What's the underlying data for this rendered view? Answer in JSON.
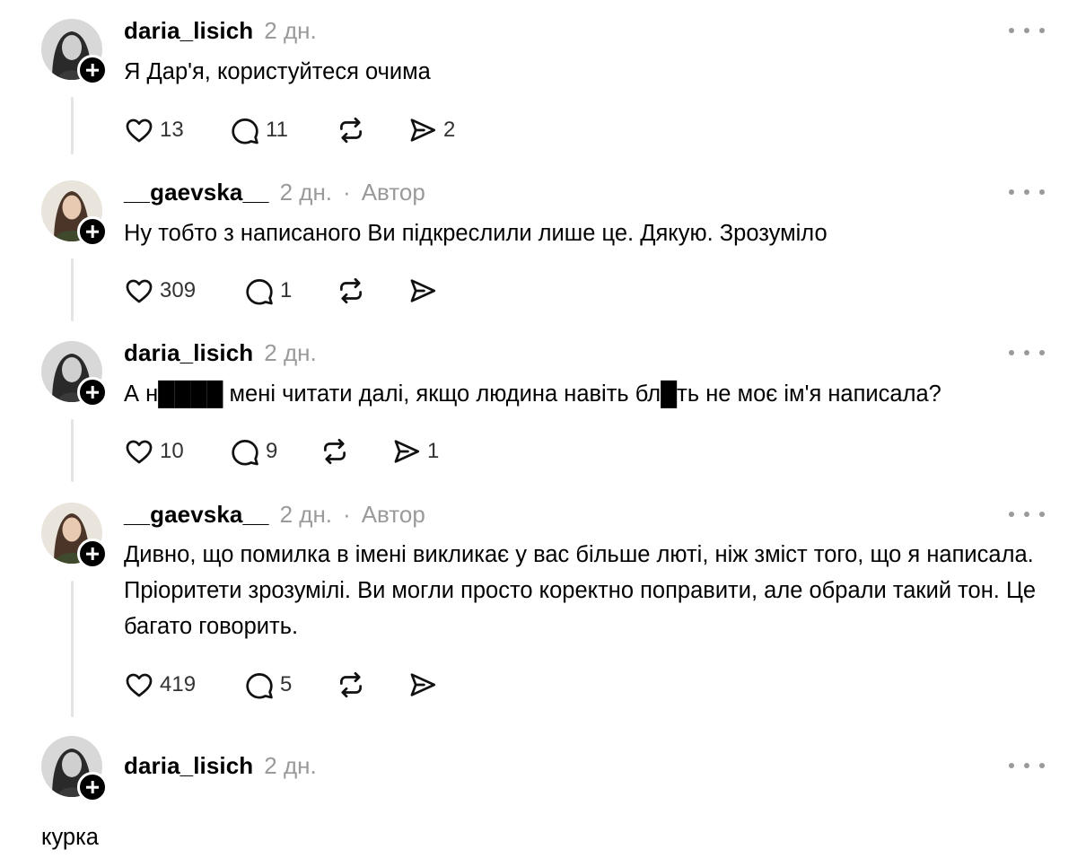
{
  "comments": [
    {
      "username": "daria_lisich",
      "time": "2 дн.",
      "badge": "",
      "text": "Я Дар'я, користуйтеся очима",
      "likes": "13",
      "replies": "11",
      "reposts": "",
      "shares": "2"
    },
    {
      "username": "__gaevska__",
      "time": "2 дн.",
      "badge": "Автор",
      "text": "Ну тобто з написаного Ви підкреслили лише це. Дякую. Зрозуміло",
      "likes": "309",
      "replies": "1",
      "reposts": "",
      "shares": ""
    },
    {
      "username": "daria_lisich",
      "time": "2 дн.",
      "badge": "",
      "text": "А н████ мені читати далі, якщо людина навіть бл█ть не моє ім'я написала?",
      "likes": "10",
      "replies": "9",
      "reposts": "",
      "shares": "1"
    },
    {
      "username": "__gaevska__",
      "time": "2 дн.",
      "badge": "Автор",
      "text": "Дивно, що помилка в імені викликає у вас більше люті, ніж зміст того, що я написала. Пріоритети зрозумілі. Ви могли просто коректно поправити, але обрали такий тон. Це багато говорить.",
      "likes": "419",
      "replies": "5",
      "reposts": "",
      "shares": ""
    },
    {
      "username": "daria_lisich",
      "time": "2 дн.",
      "badge": "",
      "text": "",
      "likes": "",
      "replies": "",
      "reposts": "",
      "shares": ""
    }
  ],
  "standalone_text": "курка",
  "icons": {
    "like": "heart-icon",
    "reply": "comment-icon",
    "repost": "repost-icon",
    "share": "share-icon",
    "more": "more-icon",
    "follow": "plus-icon"
  }
}
